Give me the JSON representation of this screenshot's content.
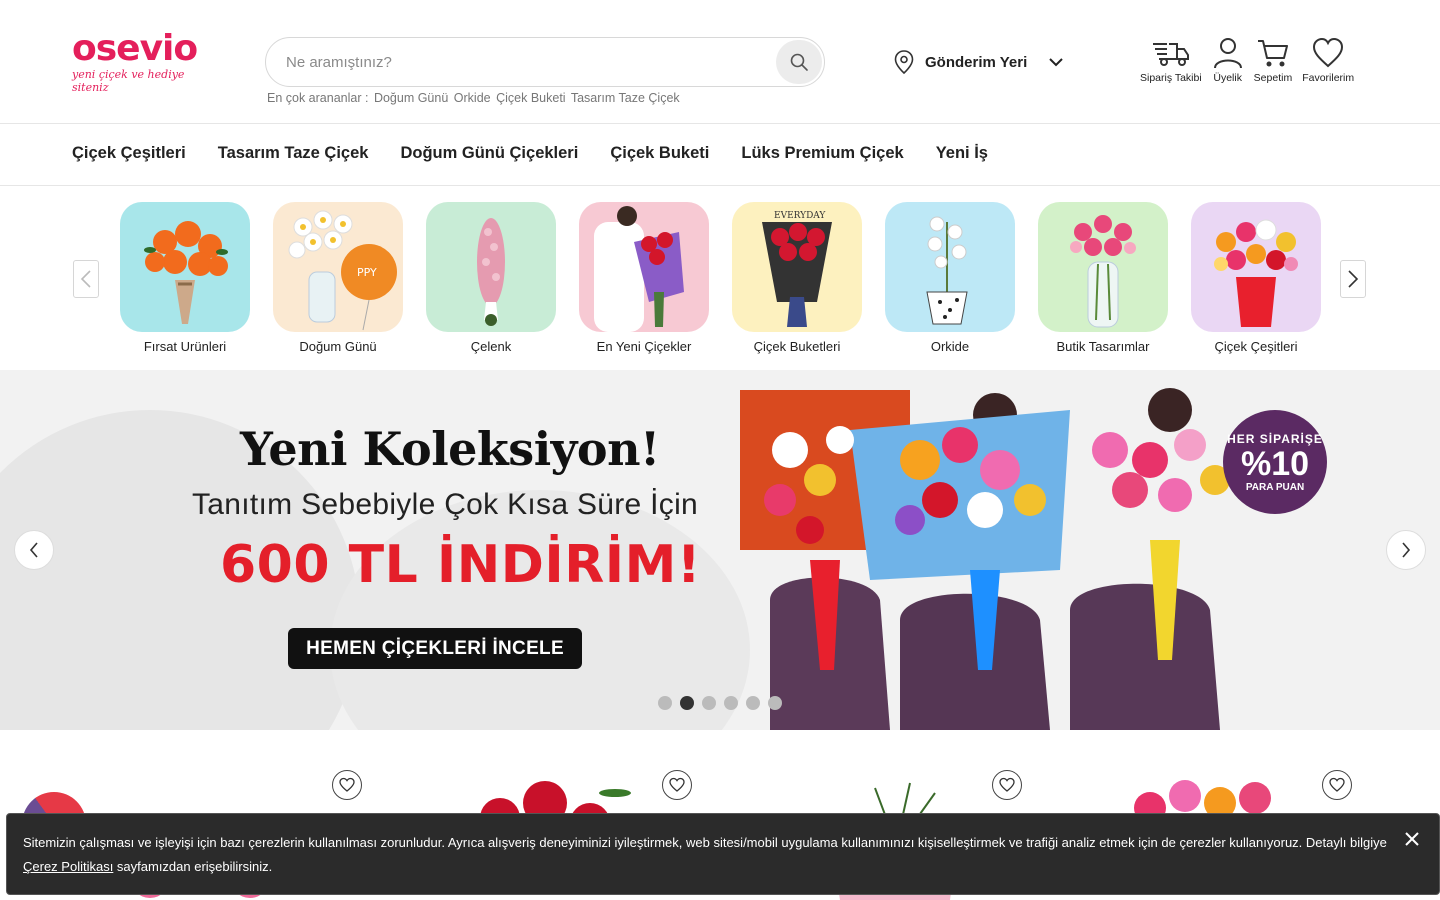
{
  "header": {
    "logo_text": "osevio",
    "logo_tagline": "yeni çiçek ve hediye siteniz",
    "search_placeholder": "Ne aramıştınız?",
    "popular_label": "En çok arananlar :",
    "popular_terms": [
      "Doğum Günü",
      "Orkide",
      "Çiçek Buketi",
      "Tasarım Taze Çiçek"
    ],
    "delivery_label": "Gönderim Yeri",
    "icons": [
      {
        "icon": "truck-icon",
        "label": "Sipariş Takibi"
      },
      {
        "icon": "user-icon",
        "label": "Üyelik"
      },
      {
        "icon": "cart-icon",
        "label": "Sepetim"
      },
      {
        "icon": "heart-icon",
        "label": "Favorilerim"
      }
    ]
  },
  "nav": {
    "items": [
      "Çiçek Çeşitleri",
      "Tasarım Taze Çiçek",
      "Doğum Günü Çiçekleri",
      "Çiçek Buketi",
      "Lüks Premium Çiçek",
      "Yeni İş"
    ]
  },
  "categories": [
    {
      "label": "Fırsat Urünleri",
      "bg": "#a8e6ea"
    },
    {
      "label": "Doğum Günü",
      "bg": "#fbe9d2"
    },
    {
      "label": "Çelenk",
      "bg": "#c8ecd6"
    },
    {
      "label": "En Yeni Çiçekler",
      "bg": "#f7c9d3"
    },
    {
      "label": "Çiçek Buketleri",
      "bg": "#fdf1bf"
    },
    {
      "label": "Orkide",
      "bg": "#bde8f6"
    },
    {
      "label": "Butik Tasarımlar",
      "bg": "#d3f1c9"
    },
    {
      "label": "Çiçek Çeşitleri",
      "bg": "#ead7f4"
    }
  ],
  "banner": {
    "title": "Yeni Koleksiyon!",
    "subtitle": "Tanıtım Sebebiyle Çok Kısa Süre İçin",
    "discount": "600 TL İNDİRİM!",
    "cta": "HEMEN ÇİÇEKLERİ İNCELE",
    "badge_top": "HER SİPARİŞE",
    "badge_pct": "%10",
    "badge_bottom": "PARA PUAN",
    "dot_count": 6,
    "active_dot": 2
  },
  "cookie": {
    "text": "Sitemizin çalışması ve işleyişi için bazı çerezlerin kullanılması zorunludur. Ayrıca alışveriş deneyiminizi iyileştirmek, web sitesi/mobil uygulama kullanımınızı kişiselleştirmek ve trafiği analiz etmek için de çerezler kullanıyoruz. Detaylı bilgiye ",
    "link": "Çerez Politikası",
    "suffix": " sayfamızdan erişebilirsiniz."
  },
  "colors": {
    "brand": "#e41f5b",
    "discount_red": "#e41f2a",
    "badge_purple": "#5b2a63",
    "cookie_bg": "#2b2b2b"
  }
}
